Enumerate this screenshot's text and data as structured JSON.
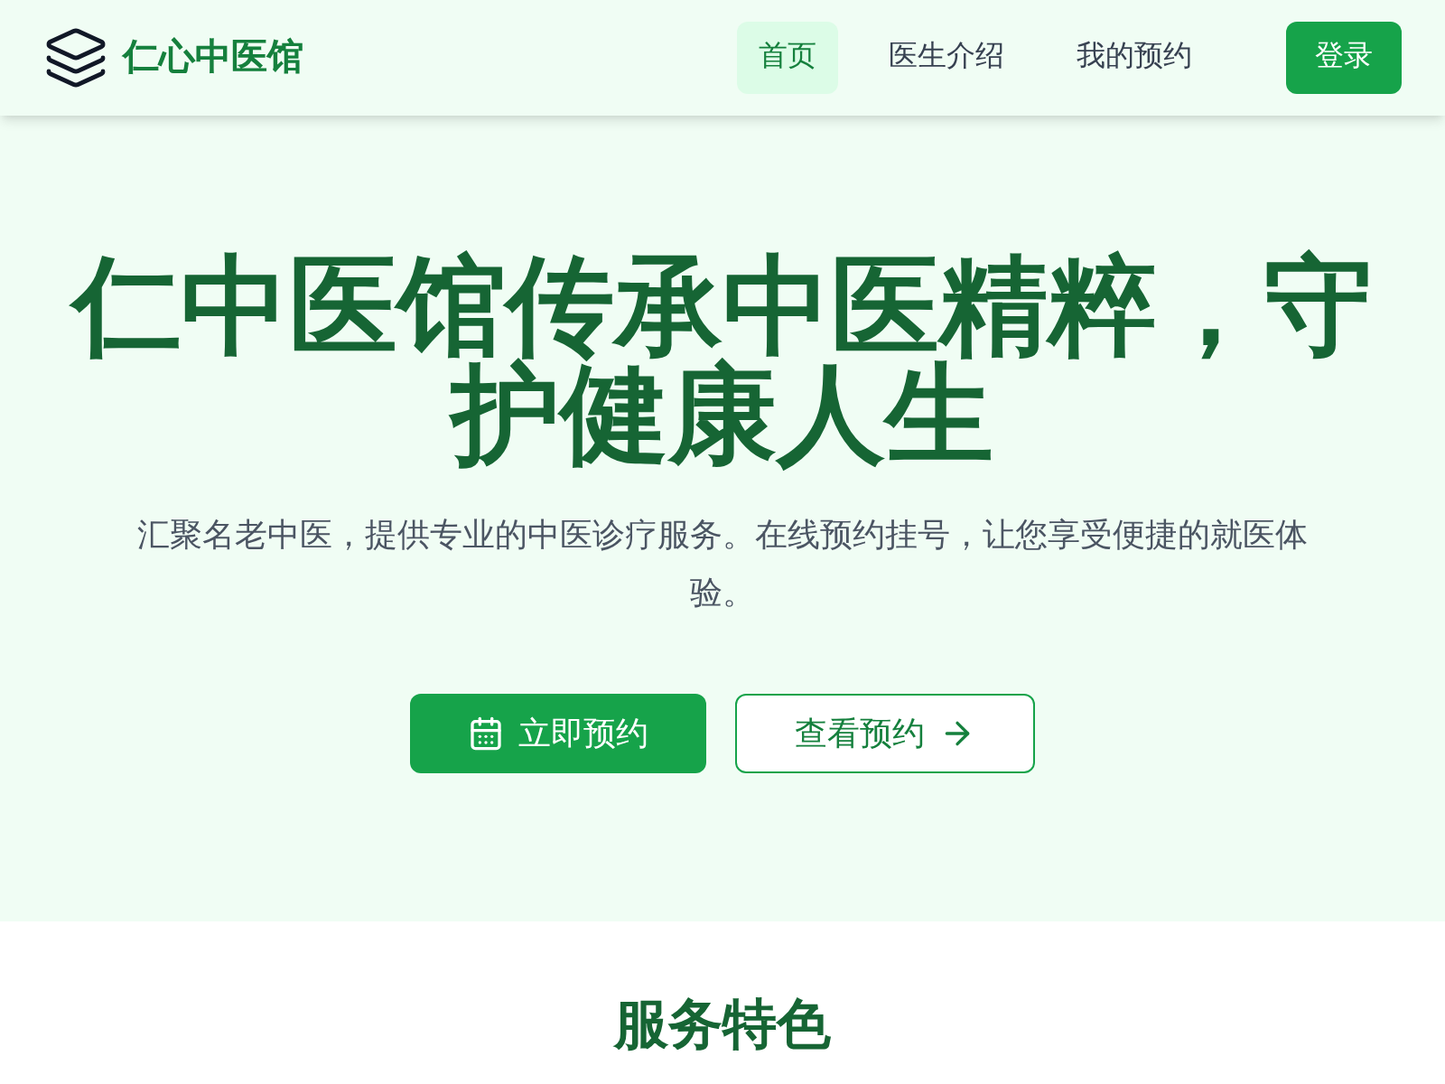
{
  "brand": {
    "name": "仁心中医馆"
  },
  "nav": [
    {
      "label": "首页",
      "selected": true
    },
    {
      "label": "医生介绍",
      "selected": false
    },
    {
      "label": "我的预约",
      "selected": false
    }
  ],
  "login_button": "登录",
  "hero": {
    "title": "仁中医馆传承中医精粹，守护健康人生",
    "subtitle": "汇聚名老中医，提供专业的中医诊疗服务。在线预约挂号，让您享受便捷的就医体验。",
    "buttons": [
      {
        "label": "立即预约",
        "kind": "primary"
      },
      {
        "label": "查看预约",
        "kind": "outline"
      }
    ]
  },
  "features": {
    "title": "服务特色"
  }
}
